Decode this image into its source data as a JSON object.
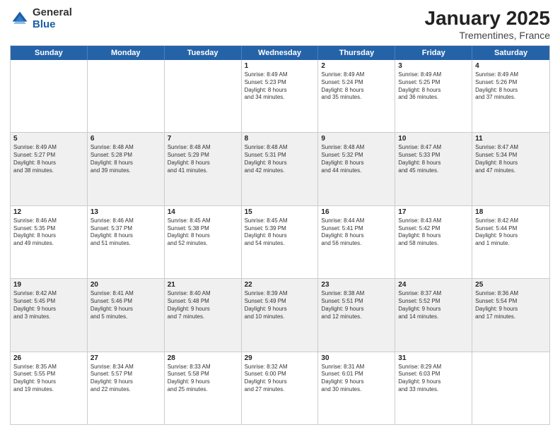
{
  "logo": {
    "general": "General",
    "blue": "Blue"
  },
  "title": {
    "month": "January 2025",
    "location": "Trementines, France"
  },
  "header_days": [
    "Sunday",
    "Monday",
    "Tuesday",
    "Wednesday",
    "Thursday",
    "Friday",
    "Saturday"
  ],
  "rows": [
    {
      "alt": false,
      "cells": [
        {
          "day": "",
          "text": ""
        },
        {
          "day": "",
          "text": ""
        },
        {
          "day": "",
          "text": ""
        },
        {
          "day": "1",
          "text": "Sunrise: 8:49 AM\nSunset: 5:23 PM\nDaylight: 8 hours\nand 34 minutes."
        },
        {
          "day": "2",
          "text": "Sunrise: 8:49 AM\nSunset: 5:24 PM\nDaylight: 8 hours\nand 35 minutes."
        },
        {
          "day": "3",
          "text": "Sunrise: 8:49 AM\nSunset: 5:25 PM\nDaylight: 8 hours\nand 36 minutes."
        },
        {
          "day": "4",
          "text": "Sunrise: 8:49 AM\nSunset: 5:26 PM\nDaylight: 8 hours\nand 37 minutes."
        }
      ]
    },
    {
      "alt": true,
      "cells": [
        {
          "day": "5",
          "text": "Sunrise: 8:49 AM\nSunset: 5:27 PM\nDaylight: 8 hours\nand 38 minutes."
        },
        {
          "day": "6",
          "text": "Sunrise: 8:48 AM\nSunset: 5:28 PM\nDaylight: 8 hours\nand 39 minutes."
        },
        {
          "day": "7",
          "text": "Sunrise: 8:48 AM\nSunset: 5:29 PM\nDaylight: 8 hours\nand 41 minutes."
        },
        {
          "day": "8",
          "text": "Sunrise: 8:48 AM\nSunset: 5:31 PM\nDaylight: 8 hours\nand 42 minutes."
        },
        {
          "day": "9",
          "text": "Sunrise: 8:48 AM\nSunset: 5:32 PM\nDaylight: 8 hours\nand 44 minutes."
        },
        {
          "day": "10",
          "text": "Sunrise: 8:47 AM\nSunset: 5:33 PM\nDaylight: 8 hours\nand 45 minutes."
        },
        {
          "day": "11",
          "text": "Sunrise: 8:47 AM\nSunset: 5:34 PM\nDaylight: 8 hours\nand 47 minutes."
        }
      ]
    },
    {
      "alt": false,
      "cells": [
        {
          "day": "12",
          "text": "Sunrise: 8:46 AM\nSunset: 5:35 PM\nDaylight: 8 hours\nand 49 minutes."
        },
        {
          "day": "13",
          "text": "Sunrise: 8:46 AM\nSunset: 5:37 PM\nDaylight: 8 hours\nand 51 minutes."
        },
        {
          "day": "14",
          "text": "Sunrise: 8:45 AM\nSunset: 5:38 PM\nDaylight: 8 hours\nand 52 minutes."
        },
        {
          "day": "15",
          "text": "Sunrise: 8:45 AM\nSunset: 5:39 PM\nDaylight: 8 hours\nand 54 minutes."
        },
        {
          "day": "16",
          "text": "Sunrise: 8:44 AM\nSunset: 5:41 PM\nDaylight: 8 hours\nand 56 minutes."
        },
        {
          "day": "17",
          "text": "Sunrise: 8:43 AM\nSunset: 5:42 PM\nDaylight: 8 hours\nand 58 minutes."
        },
        {
          "day": "18",
          "text": "Sunrise: 8:42 AM\nSunset: 5:44 PM\nDaylight: 9 hours\nand 1 minute."
        }
      ]
    },
    {
      "alt": true,
      "cells": [
        {
          "day": "19",
          "text": "Sunrise: 8:42 AM\nSunset: 5:45 PM\nDaylight: 9 hours\nand 3 minutes."
        },
        {
          "day": "20",
          "text": "Sunrise: 8:41 AM\nSunset: 5:46 PM\nDaylight: 9 hours\nand 5 minutes."
        },
        {
          "day": "21",
          "text": "Sunrise: 8:40 AM\nSunset: 5:48 PM\nDaylight: 9 hours\nand 7 minutes."
        },
        {
          "day": "22",
          "text": "Sunrise: 8:39 AM\nSunset: 5:49 PM\nDaylight: 9 hours\nand 10 minutes."
        },
        {
          "day": "23",
          "text": "Sunrise: 8:38 AM\nSunset: 5:51 PM\nDaylight: 9 hours\nand 12 minutes."
        },
        {
          "day": "24",
          "text": "Sunrise: 8:37 AM\nSunset: 5:52 PM\nDaylight: 9 hours\nand 14 minutes."
        },
        {
          "day": "25",
          "text": "Sunrise: 8:36 AM\nSunset: 5:54 PM\nDaylight: 9 hours\nand 17 minutes."
        }
      ]
    },
    {
      "alt": false,
      "cells": [
        {
          "day": "26",
          "text": "Sunrise: 8:35 AM\nSunset: 5:55 PM\nDaylight: 9 hours\nand 19 minutes."
        },
        {
          "day": "27",
          "text": "Sunrise: 8:34 AM\nSunset: 5:57 PM\nDaylight: 9 hours\nand 22 minutes."
        },
        {
          "day": "28",
          "text": "Sunrise: 8:33 AM\nSunset: 5:58 PM\nDaylight: 9 hours\nand 25 minutes."
        },
        {
          "day": "29",
          "text": "Sunrise: 8:32 AM\nSunset: 6:00 PM\nDaylight: 9 hours\nand 27 minutes."
        },
        {
          "day": "30",
          "text": "Sunrise: 8:31 AM\nSunset: 6:01 PM\nDaylight: 9 hours\nand 30 minutes."
        },
        {
          "day": "31",
          "text": "Sunrise: 8:29 AM\nSunset: 6:03 PM\nDaylight: 9 hours\nand 33 minutes."
        },
        {
          "day": "",
          "text": ""
        }
      ]
    }
  ]
}
